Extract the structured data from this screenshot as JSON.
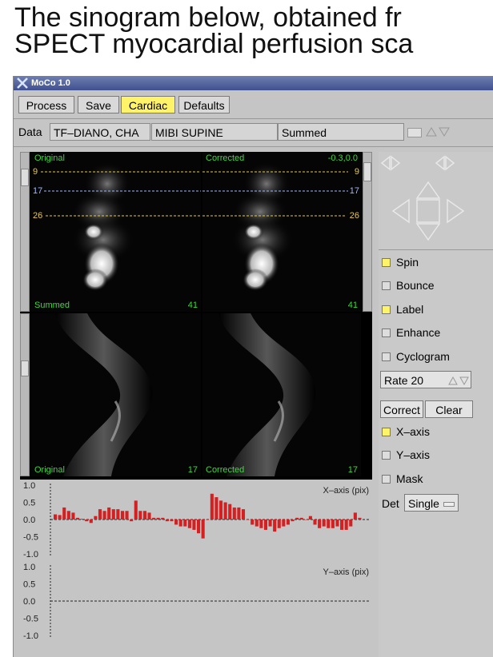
{
  "question": {
    "line1": "The sinogram below, obtained fr",
    "line2": "SPECT myocardial perfusion sca"
  },
  "window": {
    "title": "MoCo 1.0"
  },
  "menu": {
    "process": "Process",
    "save": "Save",
    "cardiac": "Cardiac",
    "defaults": "Defaults",
    "active_color": "#fff36a"
  },
  "databar": {
    "label": "Data",
    "patient": "TF–DIANO, CHA",
    "study": "MIBI SUPINE",
    "mode": "Summed"
  },
  "panels": {
    "top_left": {
      "label": "Original",
      "bottom_left": "Summed",
      "bottom_right": "41"
    },
    "top_right": {
      "label": "Corrected",
      "offset": "-0.3,0.0",
      "bottom_right": "41"
    },
    "bottom_left": {
      "bottom_left": "Original",
      "bottom_right": "17"
    },
    "bottom_right": {
      "bottom_left": "Corrected",
      "bottom_right": "17"
    },
    "lines_left": [
      "9",
      "17",
      "26"
    ],
    "lines_right": [
      "9",
      "17",
      "26"
    ]
  },
  "options": {
    "spin": {
      "label": "Spin",
      "checked": true
    },
    "bounce": {
      "label": "Bounce",
      "checked": false
    },
    "label": {
      "label": "Label",
      "checked": true
    },
    "enhance": {
      "label": "Enhance",
      "checked": false
    },
    "cyclogram": {
      "label": "Cyclogram",
      "checked": false
    },
    "rate": "Rate 20",
    "correct": "Correct",
    "clear": "Clear",
    "xaxis": {
      "label": "X–axis",
      "checked": true
    },
    "yaxis": {
      "label": "Y–axis",
      "checked": false
    },
    "mask": {
      "label": "Mask",
      "checked": false
    },
    "det_label": "Det",
    "det_value": "Single"
  },
  "chart_data": [
    {
      "type": "bar",
      "title": "X–axis (pix)",
      "ylim": [
        -1.0,
        1.0
      ],
      "yticks": [
        "1.0",
        "0.5",
        "0.0",
        "-0.5",
        "-1.0"
      ],
      "bar_color": "#d42020",
      "values": [
        0.15,
        0.13,
        0.35,
        0.25,
        0.2,
        0.05,
        0.02,
        -0.05,
        -0.1,
        0.1,
        0.3,
        0.25,
        0.35,
        0.3,
        0.3,
        0.25,
        0.25,
        -0.05,
        0.55,
        0.25,
        0.25,
        0.2,
        0.05,
        0.05,
        0.05,
        -0.05,
        -0.05,
        -0.15,
        -0.2,
        -0.2,
        -0.25,
        -0.3,
        -0.4,
        -0.55,
        0.0,
        0.75,
        0.65,
        0.55,
        0.5,
        0.45,
        0.35,
        0.35,
        0.3,
        0.0,
        -0.15,
        -0.2,
        -0.25,
        -0.3,
        -0.2,
        -0.35,
        -0.25,
        -0.2,
        -0.15,
        -0.05,
        0.05,
        0.05,
        0.0,
        0.1,
        -0.15,
        -0.25,
        -0.2,
        -0.25,
        -0.25,
        -0.2,
        -0.3,
        -0.3,
        -0.2,
        0.2,
        0.05
      ]
    },
    {
      "type": "bar",
      "title": "Y–axis (pix)",
      "ylim": [
        -1.0,
        1.0
      ],
      "yticks": [
        "1.0",
        "0.5",
        "0.0",
        "-0.5",
        "-1.0"
      ],
      "values": []
    }
  ]
}
